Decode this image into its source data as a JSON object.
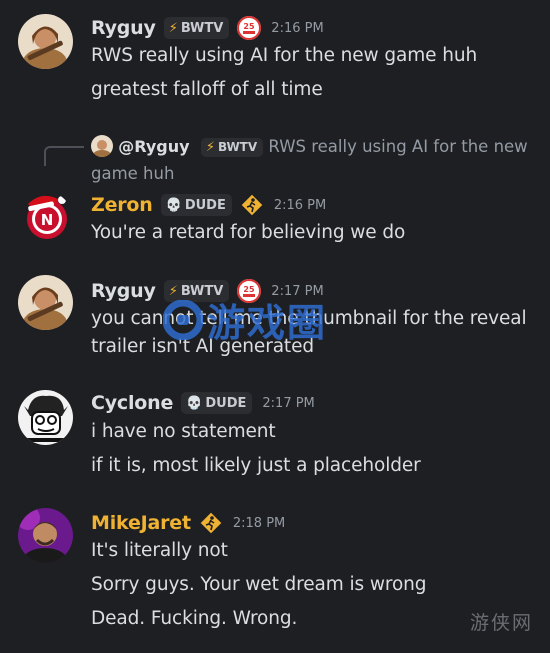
{
  "messages": [
    {
      "username": "Ryguy",
      "name_color": "#dbdee1",
      "tag": "BWTV",
      "tag_icon": "lightning-icon",
      "badge": "25",
      "time": "2:16 PM",
      "lines": [
        "RWS really using AI for the new game huh",
        "greatest falloff of all time"
      ]
    },
    {
      "reply": {
        "mention": "@Ryguy",
        "tag": "BWTV",
        "text": "RWS really using AI for the new game huh"
      },
      "username": "Zeron",
      "name_color": "#f0b232",
      "tag": "DUDE",
      "tag_icon": "skull-icon",
      "badge": "runner",
      "time": "2:16 PM",
      "lines": [
        "You're a retard for believing we do"
      ]
    },
    {
      "username": "Ryguy",
      "name_color": "#dbdee1",
      "tag": "BWTV",
      "tag_icon": "lightning-icon",
      "badge": "25",
      "time": "2:17 PM",
      "lines": [
        "you cannot tell me the thumbnail for the reveal",
        "trailer isn't AI generated"
      ]
    },
    {
      "username": "Cyclone",
      "name_color": "#dbdee1",
      "tag": "DUDE",
      "tag_icon": "skull-icon",
      "time": "2:17 PM",
      "lines": [
        "i have no statement",
        "if it is, most likely just a placeholder"
      ]
    },
    {
      "username": "MikeJaret",
      "name_color": "#f0b232",
      "badge": "runner",
      "time": "2:18 PM",
      "lines": [
        "It's literally not",
        "Sorry guys. Your wet dream is wrong",
        "Dead. Fucking. Wrong."
      ]
    }
  ],
  "watermark": {
    "text": "游戏圈"
  },
  "corner_mark": {
    "text": "游侠网"
  },
  "colors": {
    "background": "#1e1f22",
    "muted": "#949ba4",
    "gold_name": "#f0b232",
    "tag_bg": "#2b2d31"
  }
}
